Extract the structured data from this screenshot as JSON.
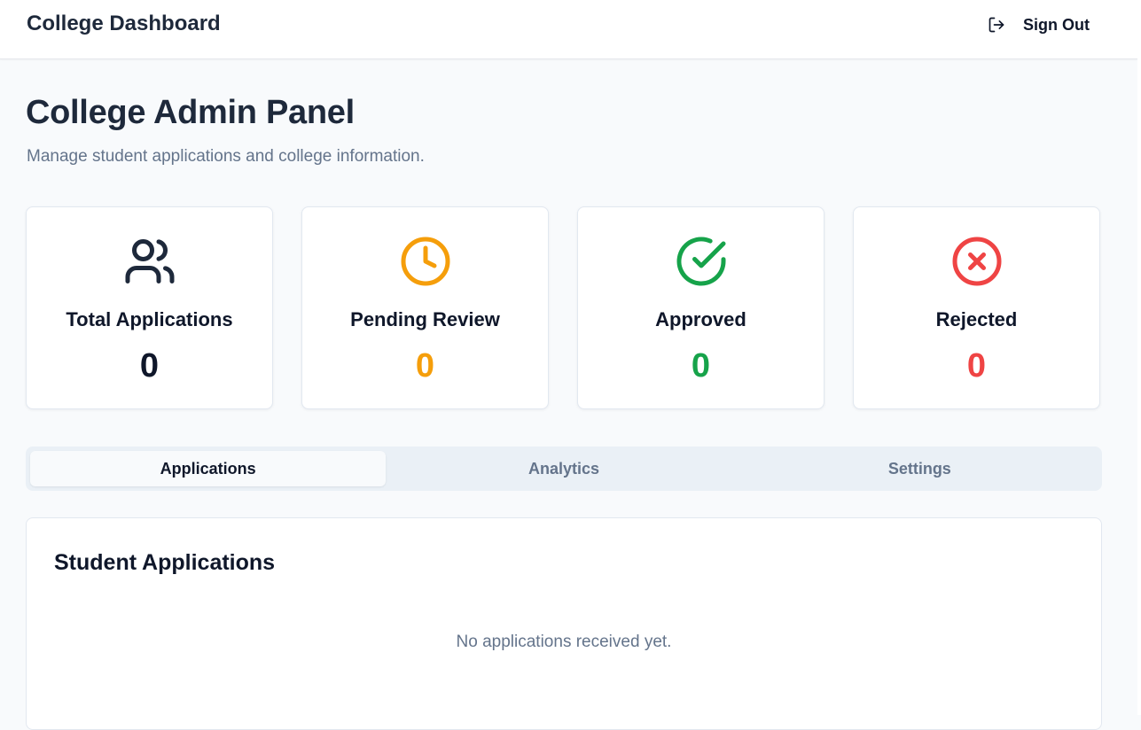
{
  "header": {
    "app_title": "College Dashboard",
    "signout_label": "Sign Out"
  },
  "page": {
    "title": "College Admin Panel",
    "subtitle": "Manage student applications and college information."
  },
  "stats": [
    {
      "icon": "users-icon",
      "label": "Total Applications",
      "value": "0",
      "color": "#0f172a"
    },
    {
      "icon": "clock-icon",
      "label": "Pending Review",
      "value": "0",
      "color": "#f59e0b"
    },
    {
      "icon": "check-circle-icon",
      "label": "Approved",
      "value": "0",
      "color": "#16a34a"
    },
    {
      "icon": "x-circle-icon",
      "label": "Rejected",
      "value": "0",
      "color": "#ef4444"
    }
  ],
  "tabs": [
    {
      "label": "Applications",
      "active": true
    },
    {
      "label": "Analytics",
      "active": false
    },
    {
      "label": "Settings",
      "active": false
    }
  ],
  "applications_panel": {
    "title": "Student Applications",
    "empty_message": "No applications received yet."
  }
}
